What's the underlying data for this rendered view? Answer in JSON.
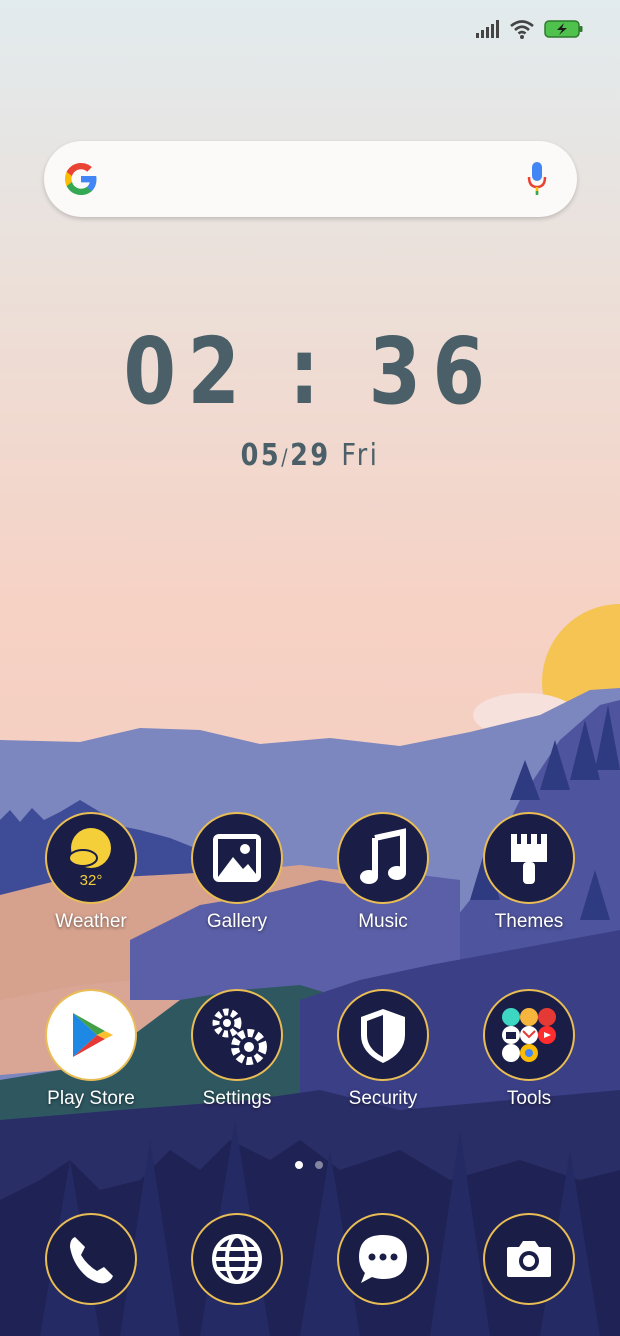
{
  "status_bar": {
    "signal_icon": "signal-icon",
    "wifi_icon": "wifi-icon",
    "battery_icon": "battery-charging-icon"
  },
  "search_bar": {
    "logo_icon": "google-logo-icon",
    "mic_icon": "microphone-icon"
  },
  "clock": {
    "time": "02 : 36",
    "date_month": "05",
    "date_separator": "/",
    "date_day": "29",
    "weekday": "Fri"
  },
  "apps_row1": [
    {
      "label": "Weather",
      "icon": "weather-icon",
      "temperature": "32°"
    },
    {
      "label": "Gallery",
      "icon": "gallery-icon"
    },
    {
      "label": "Music",
      "icon": "music-note-icon"
    },
    {
      "label": "Themes",
      "icon": "brush-icon"
    }
  ],
  "apps_row2": [
    {
      "label": "Play Store",
      "icon": "play-store-icon"
    },
    {
      "label": "Settings",
      "icon": "gears-icon"
    },
    {
      "label": "Security",
      "icon": "shield-icon"
    },
    {
      "label": "Tools",
      "icon": "folder-icon"
    }
  ],
  "page_indicator": {
    "pages": 2,
    "current": 1
  },
  "dock": [
    {
      "name": "phone",
      "icon": "phone-icon"
    },
    {
      "name": "browser",
      "icon": "globe-icon"
    },
    {
      "name": "messages",
      "icon": "chat-bubble-icon"
    },
    {
      "name": "camera",
      "icon": "camera-icon"
    }
  ],
  "colors": {
    "icon_background": "#1a1d45",
    "icon_border": "#e9bd55",
    "clock_text": "#4a5f68",
    "sun": "#f5c453"
  }
}
